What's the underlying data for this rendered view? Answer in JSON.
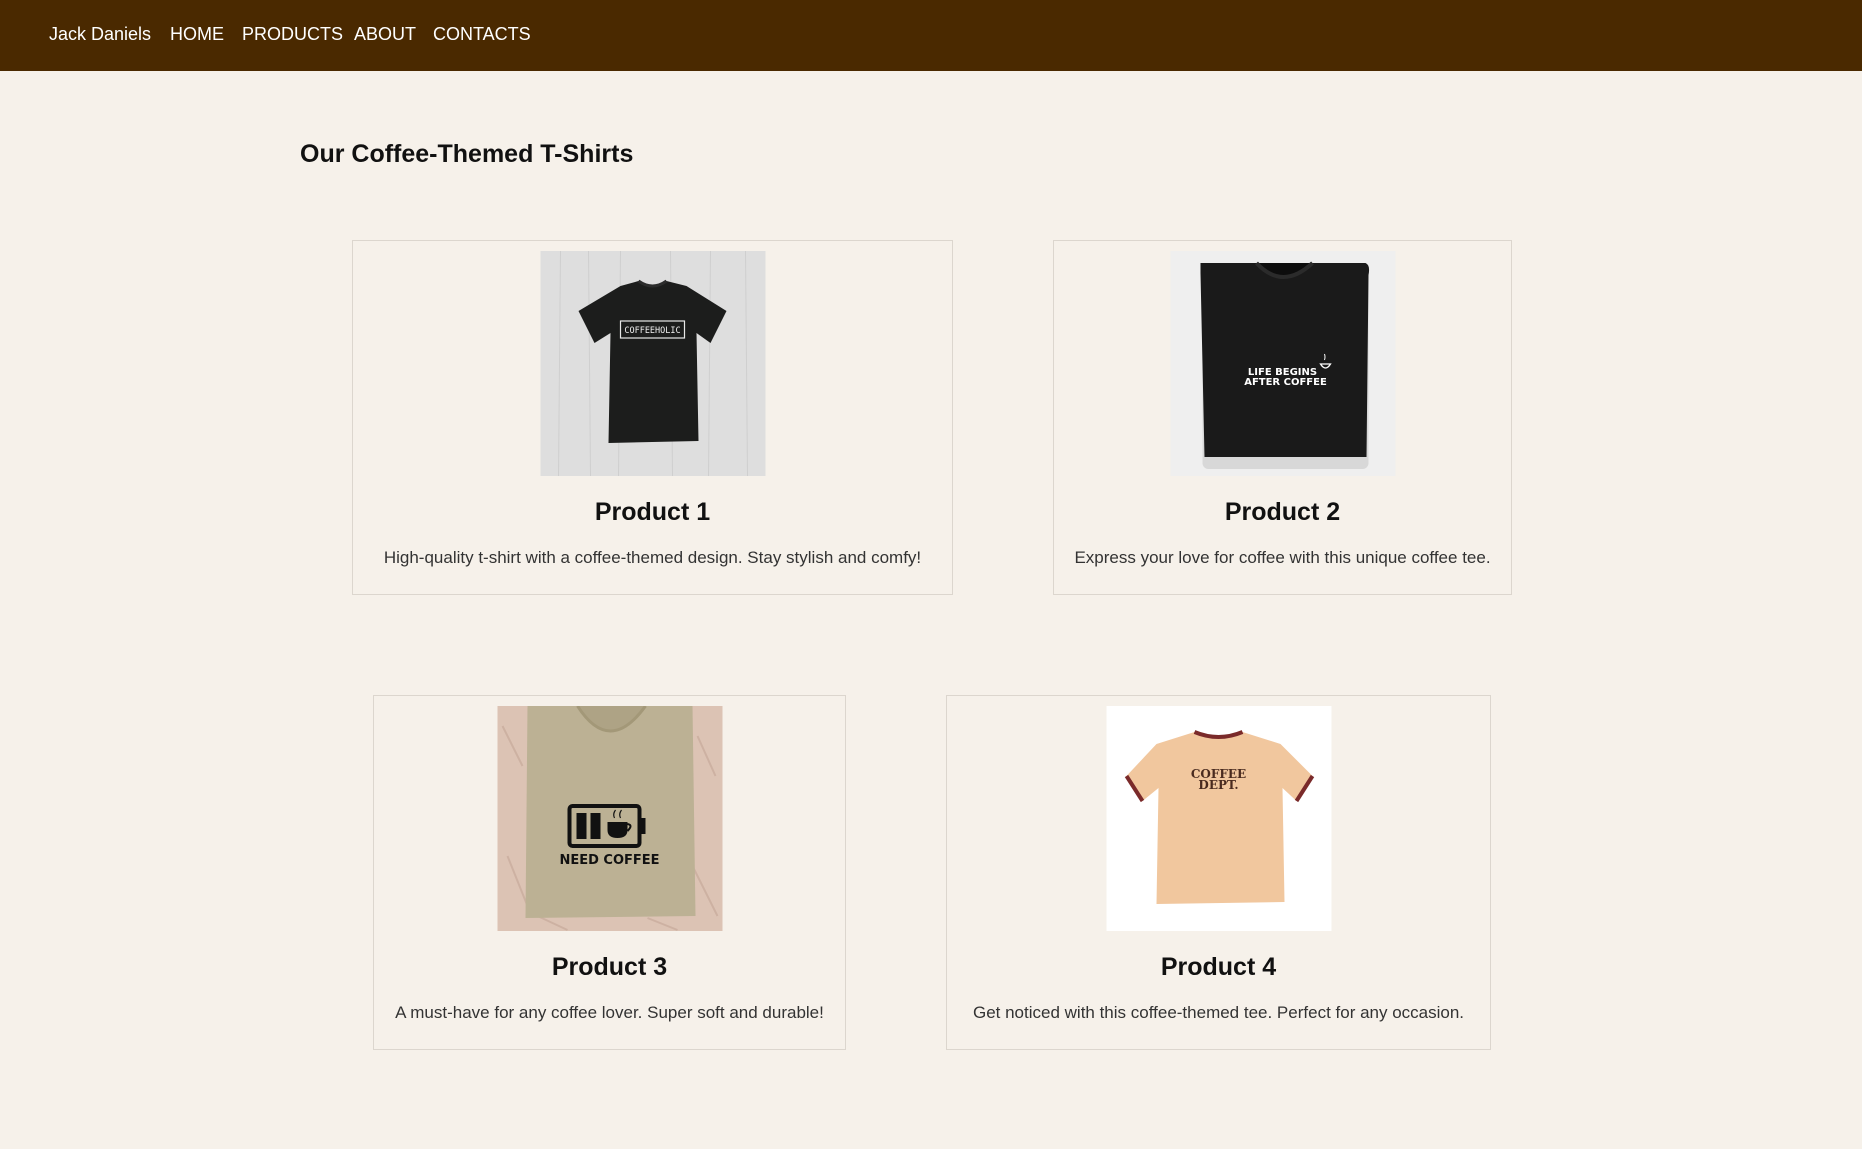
{
  "nav": {
    "brand": "Jack Daniels",
    "links": [
      "HOME",
      "PRODUCTS",
      "ABOUT",
      "CONTACTS"
    ]
  },
  "page": {
    "title": "Our Coffee-Themed T-Shirts"
  },
  "products": [
    {
      "name": "Product 1",
      "description": "High-quality t-shirt with a coffee-themed design. Stay stylish and comfy!",
      "shirt_print": "COFFEEHOLIC",
      "image": "black-tshirt-coffeeholic"
    },
    {
      "name": "Product 2",
      "description": "Express your love for coffee with this unique coffee tee.",
      "shirt_print": [
        "LIFE BEGINS",
        "AFTER COFFEE"
      ],
      "image": "black-folded-tshirt-life-begins-after-coffee"
    },
    {
      "name": "Product 3",
      "description": "A must-have for any coffee lover. Super soft and durable!",
      "shirt_print": "NEED COFFEE",
      "image": "beige-folded-tshirt-need-coffee"
    },
    {
      "name": "Product 4",
      "description": "Get noticed with this coffee-themed tee. Perfect for any occasion.",
      "shirt_print": [
        "COFFEE",
        "DEPT."
      ],
      "image": "peach-ringer-tshirt-coffee-dept"
    }
  ],
  "colors": {
    "navbar": "#4a2900",
    "background": "#f6f1ea",
    "card_border": "#dcd6ce"
  }
}
